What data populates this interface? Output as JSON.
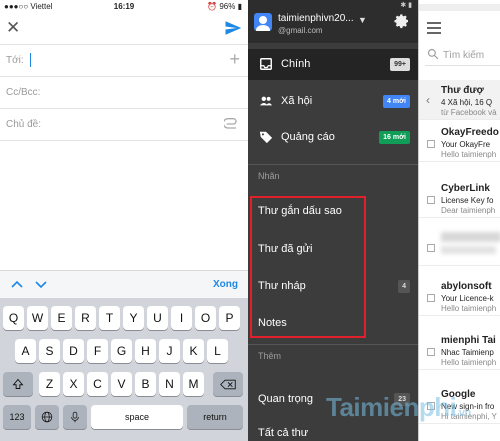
{
  "compose": {
    "status": {
      "carrier": "●●●○○ Viettel",
      "time": "16:19",
      "battery": "⏰ 96% ▮"
    },
    "to_label": "Tới:",
    "ccbcc_label": "Cc/Bcc:",
    "subject_label": "Chủ đề:",
    "done_label": "Xong",
    "keyboard": {
      "row1": [
        "Q",
        "W",
        "E",
        "R",
        "T",
        "Y",
        "U",
        "I",
        "O",
        "P"
      ],
      "row2": [
        "A",
        "S",
        "D",
        "F",
        "G",
        "H",
        "J",
        "K",
        "L"
      ],
      "row3": [
        "Z",
        "X",
        "C",
        "V",
        "B",
        "N",
        "M"
      ],
      "numbers_key": "123",
      "space_key": "space",
      "return_key": "return",
      "shift_icon": "shift-icon",
      "delete_icon": "backspace-icon",
      "globe_icon": "globe-icon",
      "mic_icon": "microphone-icon"
    }
  },
  "drawer": {
    "account_name": "taimienphivn20...",
    "account_email": "@gmail.com",
    "primary": {
      "label": "Chính",
      "badge": "99+",
      "icon": "inbox-icon"
    },
    "social": {
      "label": "Xã hội",
      "badge": "4 mới",
      "icon": "people-icon",
      "badge_color": "#4285f4"
    },
    "promotions": {
      "label": "Quảng cáo",
      "badge": "16 mới",
      "icon": "tag-icon",
      "badge_color": "#0f9d58"
    },
    "labels_header": "Nhãn",
    "starred": "Thư gắn dấu sao",
    "sent": "Thư đã gửi",
    "drafts": {
      "label": "Thư nháp",
      "badge": "4"
    },
    "notes": "Notes",
    "more_header": "Thêm",
    "important": {
      "label": "Quan trọng",
      "badge": "23"
    },
    "all_mail": "Tất cả thư"
  },
  "inbox": {
    "search_placeholder": "Tìm kiếm",
    "mails": [
      {
        "sender": "Thư đượ",
        "line1": "4 Xã hội, 16 Q",
        "line2": "từ Facebook và"
      },
      {
        "sender": "OkayFreedo",
        "line1": "Your OkayFre",
        "line2": "Hello taimienph"
      },
      {
        "sender": "CyberLink",
        "line1": "License Key fo",
        "line2": "Dear taimienph"
      },
      {
        "sender": "",
        "line1": "",
        "line2": ""
      },
      {
        "sender": "abylonsoft",
        "line1": "Your Licence-k",
        "line2": "Hello taimienph"
      },
      {
        "sender": "mienphi Tai",
        "line1": "Nhac Taimienp",
        "line2": "Hello taimienph"
      },
      {
        "sender": "Google",
        "line1": "New sign-in fro",
        "line2": "Hi taimienphi, Y"
      }
    ]
  },
  "watermark": {
    "text": "Taimienphi",
    "suffix": ".vn"
  },
  "colors": {
    "accent": "#1e88e5",
    "drawer_bg": "#3c3c3c",
    "highlight": "#e0202a"
  }
}
